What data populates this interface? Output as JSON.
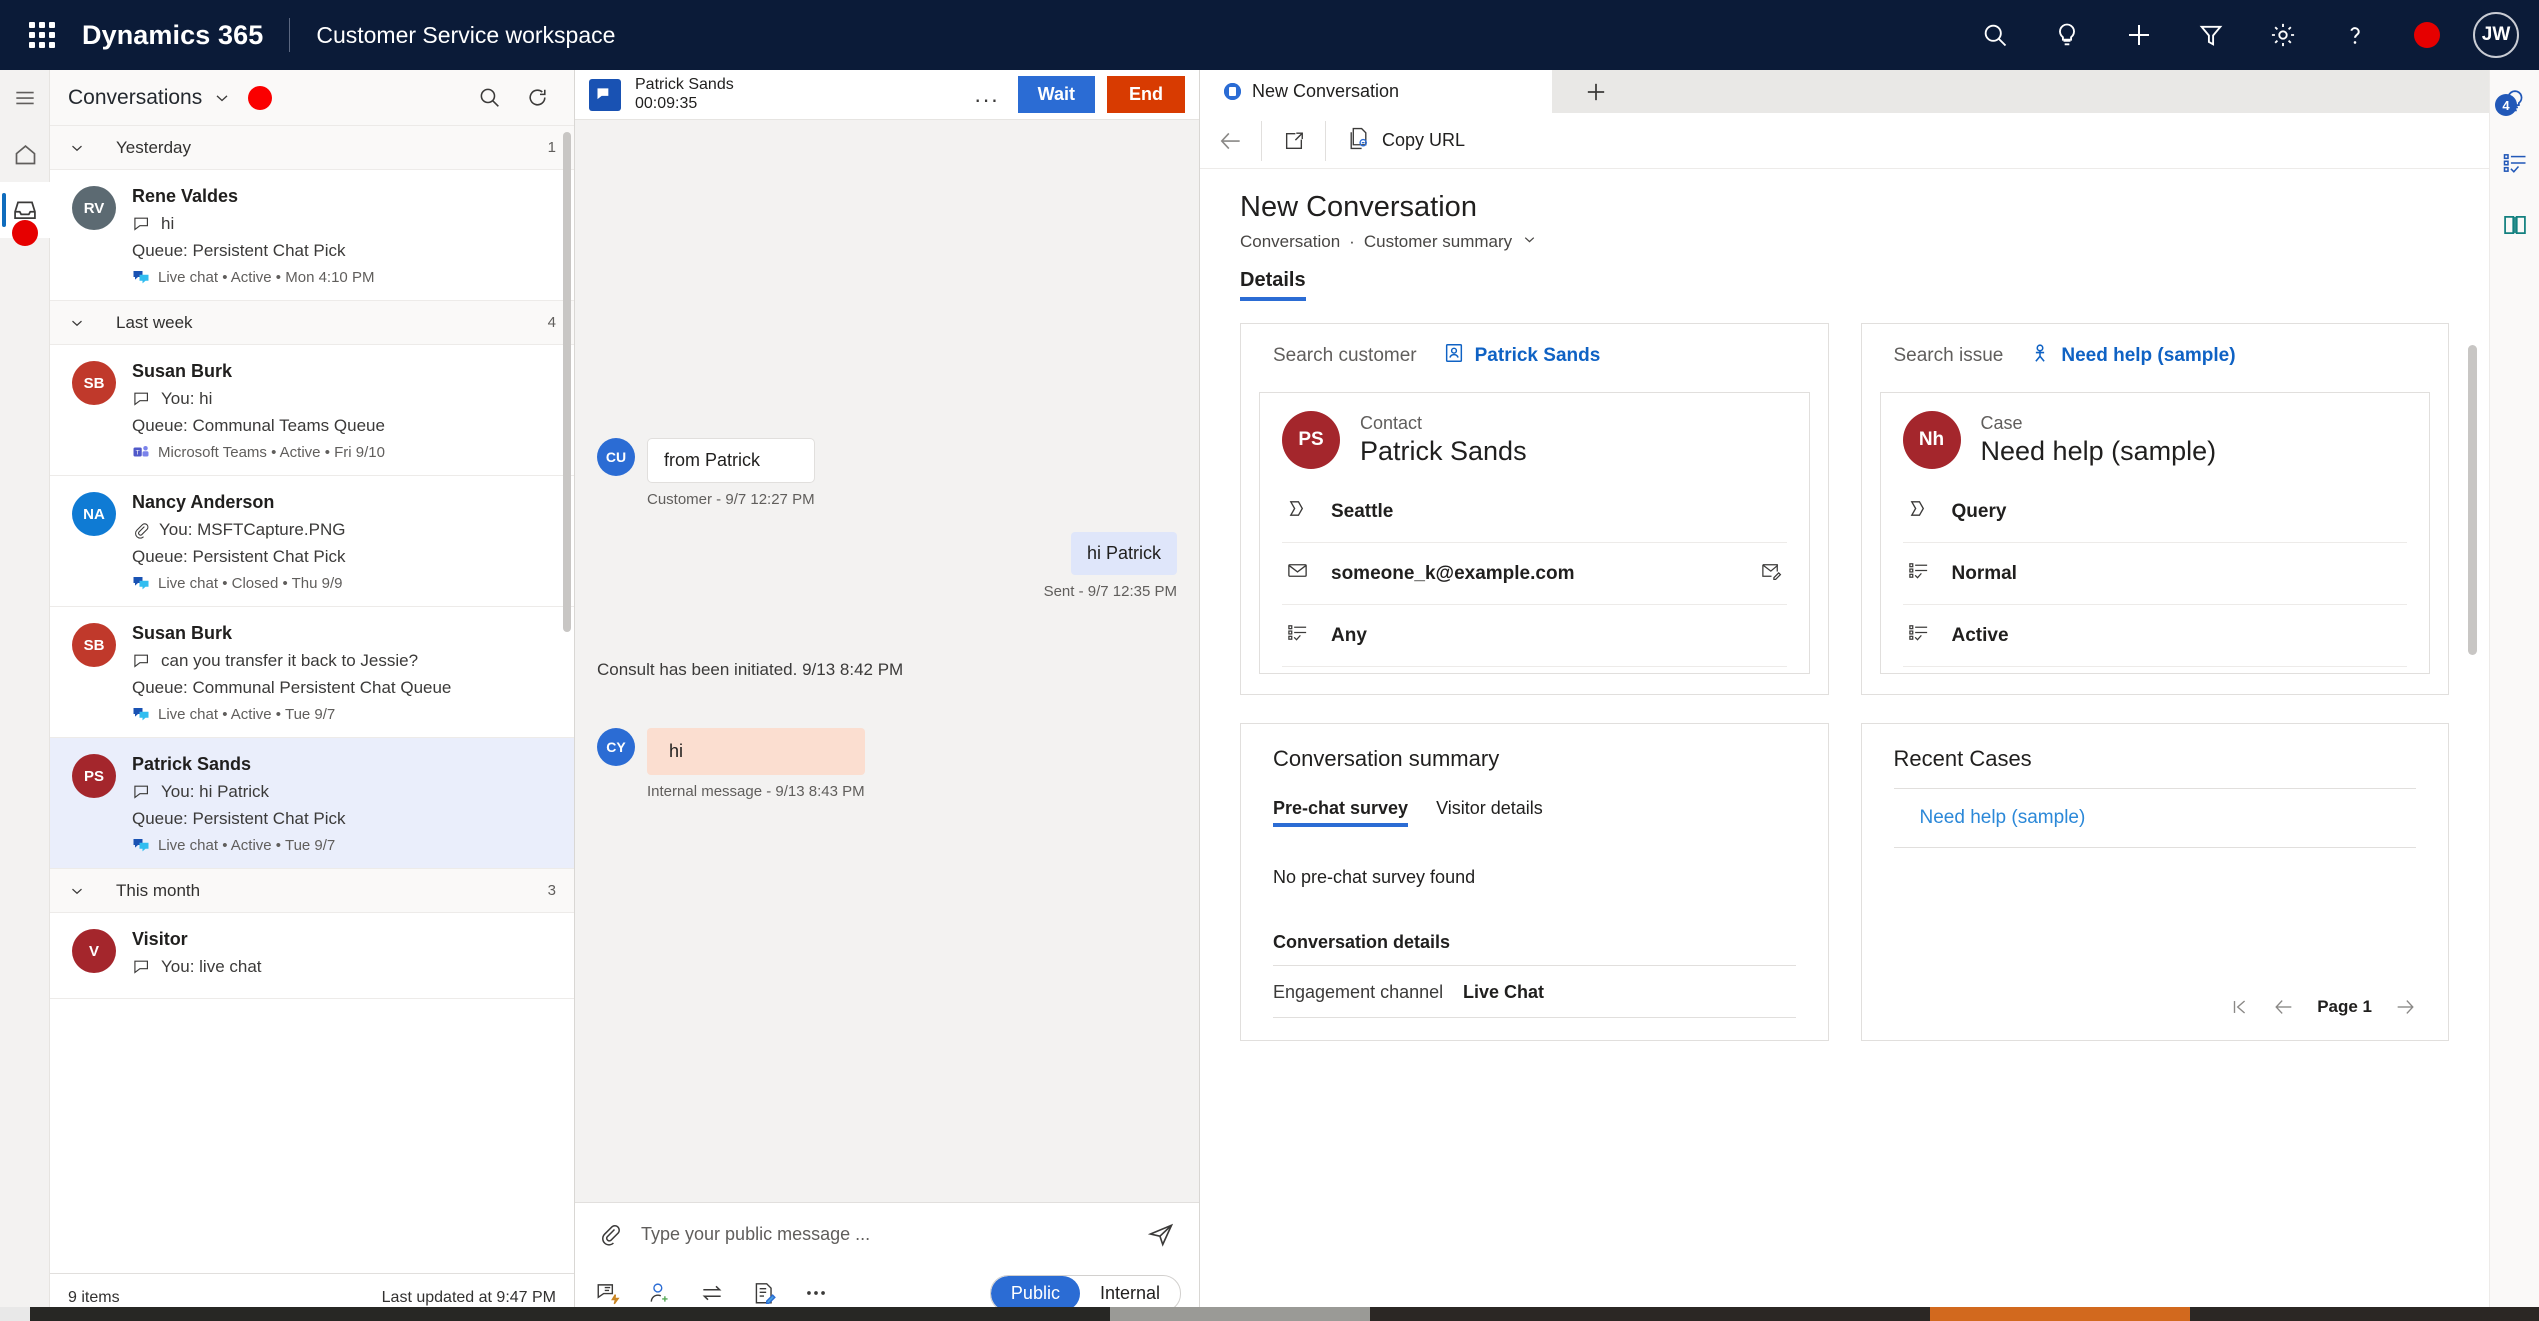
{
  "topbar": {
    "brand": "Dynamics 365",
    "app_name": "Customer Service workspace",
    "icons": [
      "waffle-icon",
      "search-icon",
      "lightbulb-icon",
      "plus-icon",
      "filter-icon",
      "gear-icon",
      "help-icon",
      "presence-dot-icon"
    ],
    "avatar_initials": "JW",
    "background_color": "#0b1b38",
    "presence_color": "#e60000"
  },
  "left_rail": {
    "items": [
      {
        "name": "hamburger-icon",
        "label": ""
      },
      {
        "name": "home-icon",
        "label": ""
      },
      {
        "name": "inbox-icon",
        "label": "",
        "active": true,
        "badge_color": "#e60000"
      }
    ]
  },
  "conversations": {
    "title": "Conversations",
    "presence_color": "#fa0000",
    "search_icon": "search-icon",
    "refresh_icon": "refresh-icon",
    "groups": [
      {
        "name": "Yesterday",
        "count": "1",
        "items": [
          {
            "initials": "RV",
            "avatar_color": "#5c6a72",
            "name": "Rene Valdes",
            "snippet_icon": "chat-icon",
            "snippet": "hi",
            "queue": "Queue: Persistent Chat Pick",
            "channel_icon": "live-chat-icon",
            "meta": "Live chat • Active • Mon 4:10 PM",
            "selected": false
          }
        ]
      },
      {
        "name": "Last week",
        "count": "4",
        "items": [
          {
            "initials": "SB",
            "avatar_color": "#c0392b",
            "name": "Susan Burk",
            "snippet_icon": "chat-icon",
            "snippet": "You: hi",
            "queue": "Queue: Communal Teams Queue",
            "channel_icon": "teams-icon",
            "meta": "Microsoft Teams • Active • Fri 9/10",
            "selected": false
          },
          {
            "initials": "NA",
            "avatar_color": "#0f7bd4",
            "name": "Nancy Anderson",
            "snippet_icon": "attachment-icon",
            "snippet": "You: MSFTCapture.PNG",
            "queue": "Queue: Persistent Chat Pick",
            "channel_icon": "live-chat-icon",
            "meta": "Live chat • Closed • Thu 9/9",
            "selected": false
          },
          {
            "initials": "SB",
            "avatar_color": "#c0392b",
            "name": "Susan Burk",
            "snippet_icon": "chat-icon",
            "snippet": "can you transfer it back to Jessie?",
            "queue": "Queue: Communal Persistent Chat Queue",
            "channel_icon": "live-chat-icon",
            "meta": "Live chat • Active • Tue 9/7",
            "selected": false
          },
          {
            "initials": "PS",
            "avatar_color": "#a4262c",
            "name": "Patrick Sands",
            "snippet_icon": "chat-icon",
            "snippet": "You: hi Patrick",
            "queue": "Queue: Persistent Chat Pick",
            "channel_icon": "live-chat-icon",
            "meta": "Live chat • Active • Tue 9/7",
            "selected": true
          }
        ]
      },
      {
        "name": "This month",
        "count": "3",
        "items": [
          {
            "initials": "V",
            "avatar_color": "#a4262c",
            "name": "Visitor",
            "snippet_icon": "chat-icon",
            "snippet": "You: live chat",
            "queue": "",
            "channel_icon": "",
            "meta": "",
            "selected": false
          }
        ]
      }
    ],
    "footer": {
      "count": "9 items",
      "updated": "Last updated at 9:47 PM"
    }
  },
  "chat": {
    "header": {
      "channel_icon": "live-chat-icon",
      "customer": "Patrick Sands",
      "timer": "00:09:35",
      "more_label": "...",
      "wait_label": "Wait",
      "end_label": "End",
      "wait_color": "#2b6cd4",
      "end_color": "#d83b01"
    },
    "messages": [
      {
        "kind": "incoming",
        "avatar": "CU",
        "text": "from Patrick",
        "stamp": "Customer - 9/7 12:27 PM"
      },
      {
        "kind": "outgoing",
        "text": "hi Patrick",
        "stamp": "Sent - 9/7 12:35 PM"
      },
      {
        "kind": "system",
        "text": "Consult has been initiated. 9/13 8:42 PM"
      },
      {
        "kind": "internal",
        "avatar": "CY",
        "text": "hi",
        "stamp": "Internal message - 9/13 8:43 PM"
      }
    ],
    "composer": {
      "attach_icon": "attachment-icon",
      "placeholder": "Type your public message ...",
      "value": "",
      "send_icon": "send-icon",
      "tools": [
        "quick-reply-icon",
        "consult-icon",
        "transfer-icon",
        "notes-icon",
        "more-icon"
      ],
      "mode_public": "Public",
      "mode_internal": "Internal",
      "mode_selected": "Public"
    }
  },
  "right_pane": {
    "tabs": [
      {
        "label": "New Conversation",
        "active": true
      }
    ],
    "add_tab_icon": "plus-icon",
    "commandbar": {
      "back_icon": "back-arrow-icon",
      "popout_icon": "popout-icon",
      "copy_url_icon": "copy-url-icon",
      "copy_url_label": "Copy URL"
    },
    "form": {
      "title": "New Conversation",
      "breadcrumb_entity": "Conversation",
      "breadcrumb_form": "Customer summary",
      "tabs": [
        {
          "label": "Details",
          "active": true
        }
      ]
    },
    "customer_card": {
      "search_label": "Search customer",
      "search_value": "Patrick Sands",
      "search_value_icon": "contact-icon",
      "entity_initials": "PS",
      "entity_avatar_color": "#a4262c",
      "entity_type": "Contact",
      "entity_name": "Patrick Sands",
      "fields": [
        {
          "icon": "location-icon",
          "value": "Seattle",
          "trail_icon": ""
        },
        {
          "icon": "email-icon",
          "value": "someone_k@example.com",
          "trail_icon": "send-email-icon"
        },
        {
          "icon": "choice-icon",
          "value": "Any",
          "trail_icon": ""
        }
      ]
    },
    "case_card": {
      "search_label": "Search issue",
      "search_value": "Need help (sample)",
      "search_value_icon": "case-person-icon",
      "entity_initials": "Nh",
      "entity_avatar_color": "#a4262c",
      "entity_type": "Case",
      "entity_name": "Need help (sample)",
      "fields": [
        {
          "icon": "case-type-icon",
          "value": "Query",
          "trail_icon": ""
        },
        {
          "icon": "choice-icon",
          "value": "Normal",
          "trail_icon": ""
        },
        {
          "icon": "choice-icon",
          "value": "Active",
          "trail_icon": ""
        }
      ]
    },
    "conversation_summary": {
      "title": "Conversation summary",
      "subtabs": [
        {
          "label": "Pre-chat survey",
          "active": true
        },
        {
          "label": "Visitor details",
          "active": false
        }
      ],
      "empty_note": "No pre-chat survey found",
      "details_heading": "Conversation details",
      "details": [
        {
          "key": "Engagement channel",
          "value": "Live Chat"
        }
      ]
    },
    "recent_cases": {
      "title": "Recent Cases",
      "items": [
        {
          "label": "Need help (sample)"
        }
      ],
      "pager": {
        "first_icon": "page-first-icon",
        "prev_icon": "page-prev-icon",
        "label": "Page 1",
        "next_icon": "page-next-icon"
      }
    }
  },
  "right_rail": {
    "items": [
      {
        "name": "smart-assist-icon",
        "badge": "4",
        "badge_color": "#2158b8"
      },
      {
        "name": "agent-script-icon",
        "badge": ""
      },
      {
        "name": "knowledge-book-icon",
        "badge": ""
      }
    ]
  }
}
